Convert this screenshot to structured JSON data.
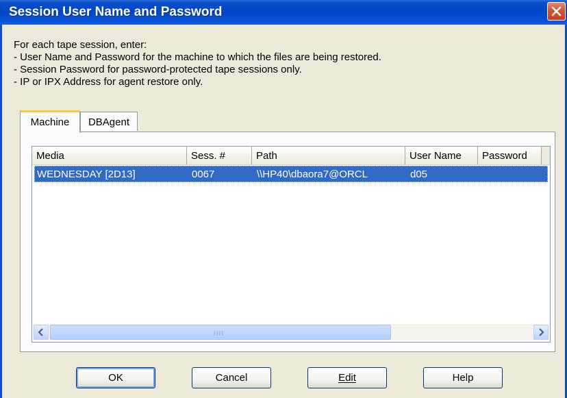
{
  "window": {
    "title": "Session User Name and Password"
  },
  "instructions": [
    "For each tape session, enter:",
    "- User Name and Password for the machine to which the files are being restored.",
    "- Session Password for password-protected tape sessions only.",
    "- IP or IPX Address for agent restore only."
  ],
  "tabs": [
    {
      "label": "Machine",
      "active": true
    },
    {
      "label": "DBAgent",
      "active": false
    }
  ],
  "table": {
    "columns": [
      "Media",
      "Sess. #",
      "Path",
      "User Name",
      "Password"
    ],
    "rows": [
      {
        "media": "WEDNESDAY [2D13]",
        "session": "0067",
        "path": "\\\\HP40\\dbaora7@ORCL",
        "user": "d05",
        "password": "",
        "selected": true
      }
    ]
  },
  "buttons": {
    "ok": "OK",
    "cancel": "Cancel",
    "edit": "Edit",
    "help": "Help"
  },
  "colors": {
    "titlebar": "#0046c8",
    "selection": "#316ac5",
    "active_tab_accent": "#ffc83c"
  }
}
